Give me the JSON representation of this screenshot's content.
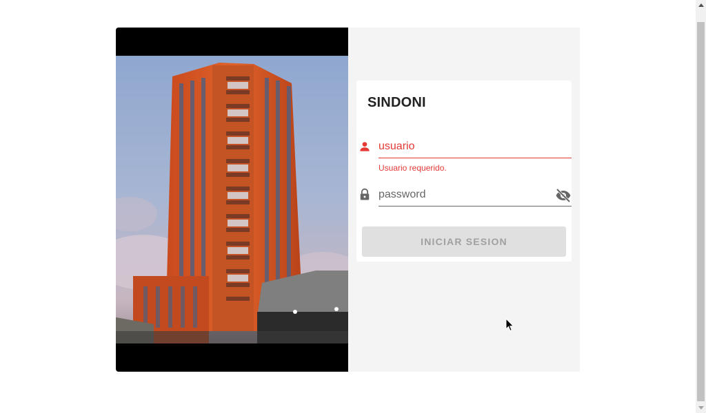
{
  "login": {
    "title": "SINDONI",
    "username": {
      "placeholder": "usuario",
      "value": "",
      "error": "Usuario requerido.",
      "icon": "person-icon"
    },
    "password": {
      "placeholder": "password",
      "value": "",
      "icon": "lock-icon",
      "toggle_icon": "eye-off-icon"
    },
    "submit_label": "INICIAR SESION"
  },
  "image": {
    "alt": "Torre de edificio"
  },
  "colors": {
    "error": "#e53935",
    "panel_bg": "#f4f4f4",
    "photo_bg": "#000000",
    "button_disabled_bg": "#e0e0e0",
    "button_disabled_text": "#a0a0a0"
  }
}
